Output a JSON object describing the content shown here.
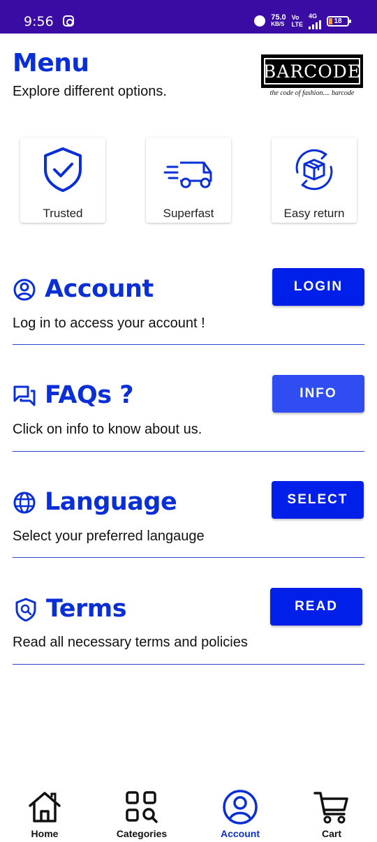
{
  "status_bar": {
    "time": "9:56",
    "speed_value": "75.0",
    "speed_unit": "KB/S",
    "net_top": "Vo",
    "net_bottom": "LTE",
    "net_type": "4G",
    "battery": "18"
  },
  "header": {
    "title": "Menu",
    "subtitle": "Explore different options.",
    "logo_text": "BARCODE",
    "logo_tagline": "the code of fashion.... barcode"
  },
  "features": [
    {
      "label": "Trusted",
      "icon": "shield-check-icon"
    },
    {
      "label": "Superfast",
      "icon": "fast-delivery-truck-icon"
    },
    {
      "label": "Easy return",
      "icon": "return-box-icon"
    }
  ],
  "sections": [
    {
      "title": "Account",
      "description": "Log in to access your account !",
      "button": "LOGIN",
      "icon": "account-circle-icon"
    },
    {
      "title": "FAQs ?",
      "description": "Click on info to know about us.",
      "button": "INFO",
      "icon": "chat-bubbles-icon"
    },
    {
      "title": "Language",
      "description": "Select your preferred langauge",
      "button": "SELECT",
      "icon": "globe-icon"
    },
    {
      "title": "Terms",
      "description": "Read all necessary terms and policies",
      "button": "READ",
      "icon": "shield-search-icon"
    }
  ],
  "bottom_nav": [
    {
      "label": "Home",
      "icon": "home-icon"
    },
    {
      "label": "Categories",
      "icon": "categories-grid-icon"
    },
    {
      "label": "Account",
      "icon": "account-icon",
      "active": true
    },
    {
      "label": "Cart",
      "icon": "cart-icon"
    }
  ],
  "colors": {
    "accent": "#0a2fd6",
    "button": "#0020ea",
    "button_light": "#2f4df0",
    "status_bar": "#3a0ca3"
  }
}
